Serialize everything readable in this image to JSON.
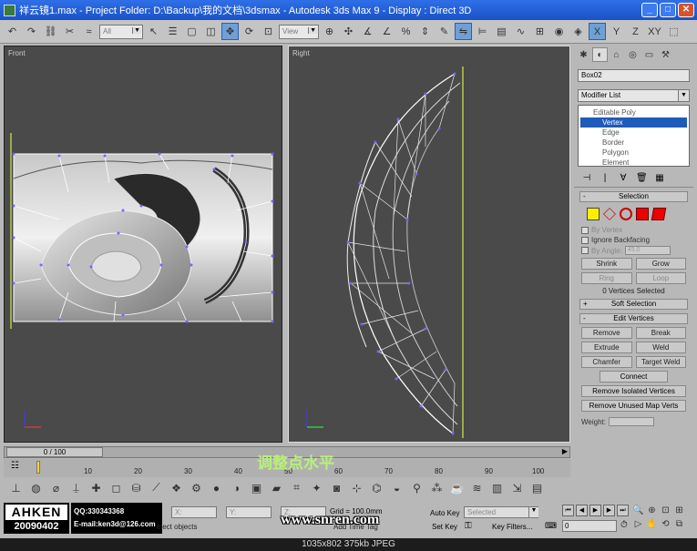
{
  "window": {
    "title": "祥云镜1.max    - Project Folder: D:\\Backup\\我的文档\\3dsmax    - Autodesk 3ds Max 9    - Display : Direct 3D",
    "minimize": "_",
    "maximize": "□",
    "close": "✕"
  },
  "toolbar": {
    "selection_filter": "All",
    "coord_system": "View"
  },
  "viewports": {
    "front_label": "Front",
    "right_label": "Right"
  },
  "command_panel": {
    "object_name": "Box02",
    "modifier_list": "Modifier List",
    "stack": [
      "Editable Poly",
      "Vertex",
      "Edge",
      "Border",
      "Polygon",
      "Element"
    ],
    "selection_rollout": "Selection",
    "by_vertex": "By Vertex",
    "ignore_backfacing": "Ignore Backfacing",
    "by_angle": "By Angle:",
    "by_angle_value": "45.0",
    "shrink": "Shrink",
    "grow": "Grow",
    "ring": "Ring",
    "loop": "Loop",
    "vertices_selected": "0 Vertices Selected",
    "soft_selection": "Soft Selection",
    "edit_vertices": "Edit Vertices",
    "remove": "Remove",
    "break": "Break",
    "extrude": "Extrude",
    "weld": "Weld",
    "chamfer": "Chamfer",
    "target_weld": "Target Weld",
    "connect": "Connect",
    "remove_isolated": "Remove Isolated Vertices",
    "remove_unused": "Remove Unused Map Verts",
    "weight": "Weight:"
  },
  "timeline": {
    "frame_display": "0 / 100",
    "ticks": [
      "10",
      "20",
      "30",
      "40",
      "50",
      "60",
      "70",
      "80",
      "90",
      "100"
    ],
    "caption": "调整点水平"
  },
  "status": {
    "logo_top": "AHKEN",
    "logo_bottom": "20090402",
    "qq": "QQ:330343368",
    "email": "E-mail:ken3d@126.com",
    "x_field": "X:",
    "y_field": "Y:",
    "z_field": "Z:",
    "grid": "Grid = 100.0mm",
    "prompt": "elect objects",
    "add_time_tag": "Add Time Tag",
    "watermark": "www.snren.com",
    "auto_key": "Auto Key",
    "selected": "Selected",
    "set_key": "Set Key",
    "key_filters": "Key Filters...",
    "frame": "0"
  },
  "image_info": "1035x802  375kb  JPEG"
}
